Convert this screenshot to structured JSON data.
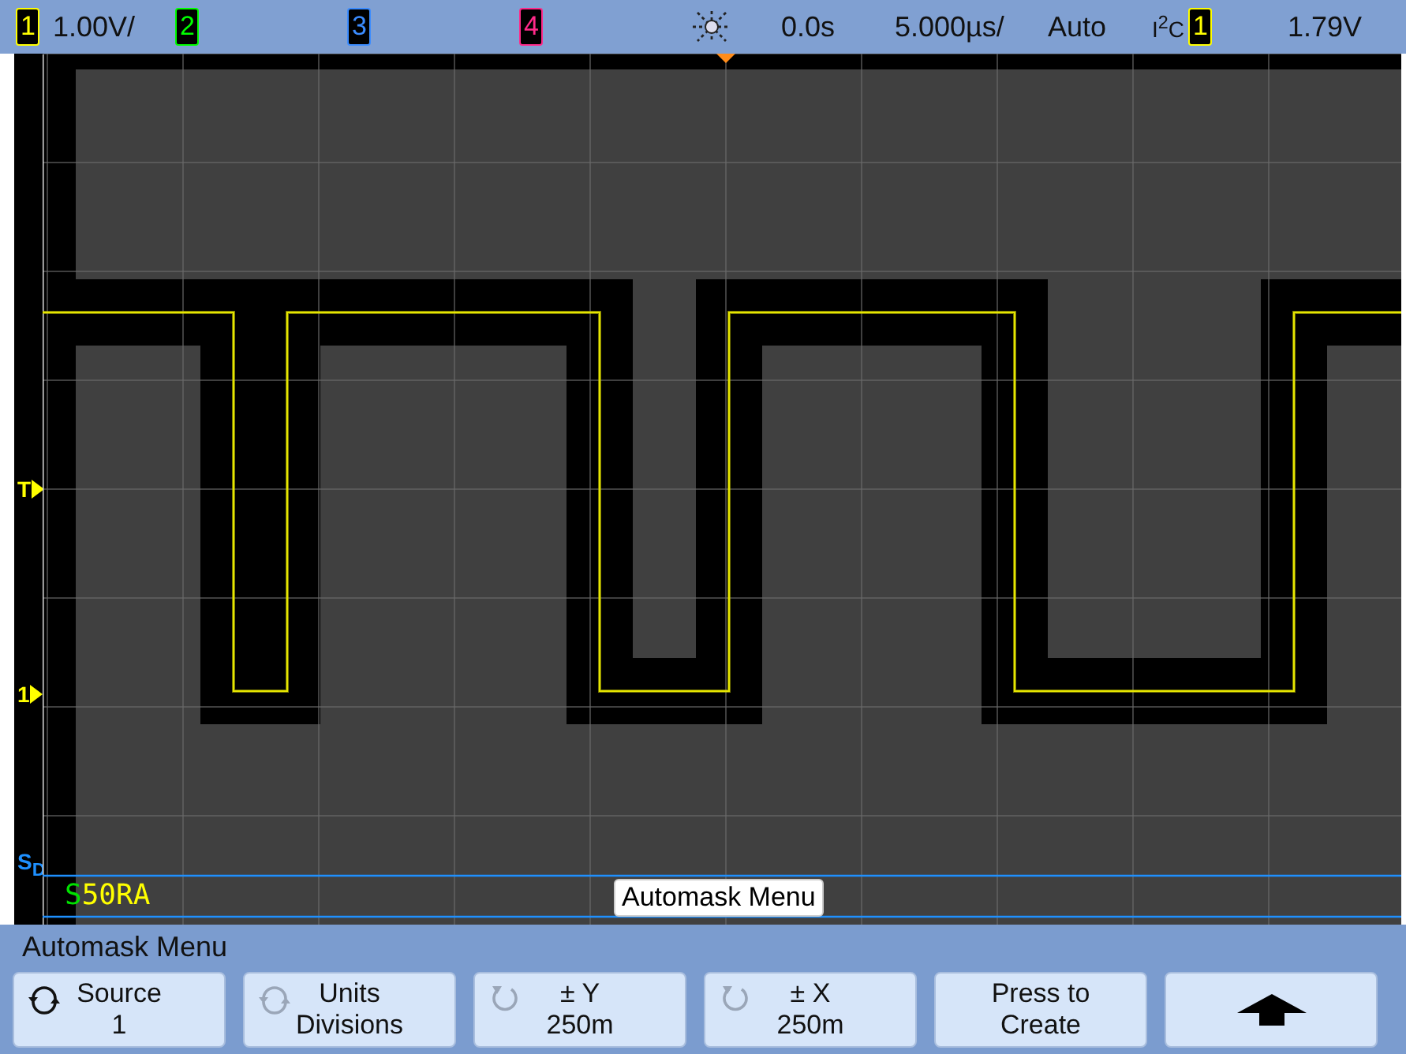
{
  "top_bar": {
    "channels": [
      {
        "label": "1",
        "color": "#ffff00",
        "scale": "1.00V/"
      },
      {
        "label": "2",
        "color": "#00ff00"
      },
      {
        "label": "3",
        "color": "#3b8cff"
      },
      {
        "label": "4",
        "color": "#ff2a8a"
      }
    ],
    "delay": "0.0s",
    "timebase": "5.000µs/",
    "trigger_mode": "Auto",
    "trigger_type": "I$^{2}$C",
    "trigger_source": {
      "label": "1",
      "color": "#ffff00"
    },
    "trigger_level": "1.79V"
  },
  "screen": {
    "markers": [
      {
        "label": "T",
        "kind": "trigger",
        "color": "#ffff00"
      },
      {
        "label": "1",
        "kind": "ground",
        "color": "#ffff00"
      },
      {
        "label": "S$_{D}$",
        "kind": "serial",
        "color": "#1e90ff"
      }
    ],
    "status": [
      {
        "text": "S",
        "color": "#00e000"
      },
      {
        "text": "50RA",
        "color": "#ffff00"
      }
    ],
    "menu_label": "Automask Menu"
  },
  "softkey_menu": {
    "title": "Automask Menu",
    "buttons": [
      {
        "kind": "knob",
        "knob_active": true,
        "line1": "Source",
        "line2": "1"
      },
      {
        "kind": "knob",
        "knob_active": false,
        "line1": "Units",
        "line2": "Divisions"
      },
      {
        "kind": "dial",
        "knob_active": false,
        "line1": "± Y",
        "line2": "250m"
      },
      {
        "kind": "dial",
        "knob_active": false,
        "line1": "± X",
        "line2": "250m"
      },
      {
        "kind": "plain",
        "line1": "Press to",
        "line2": "Create"
      },
      {
        "kind": "arrow"
      }
    ]
  }
}
